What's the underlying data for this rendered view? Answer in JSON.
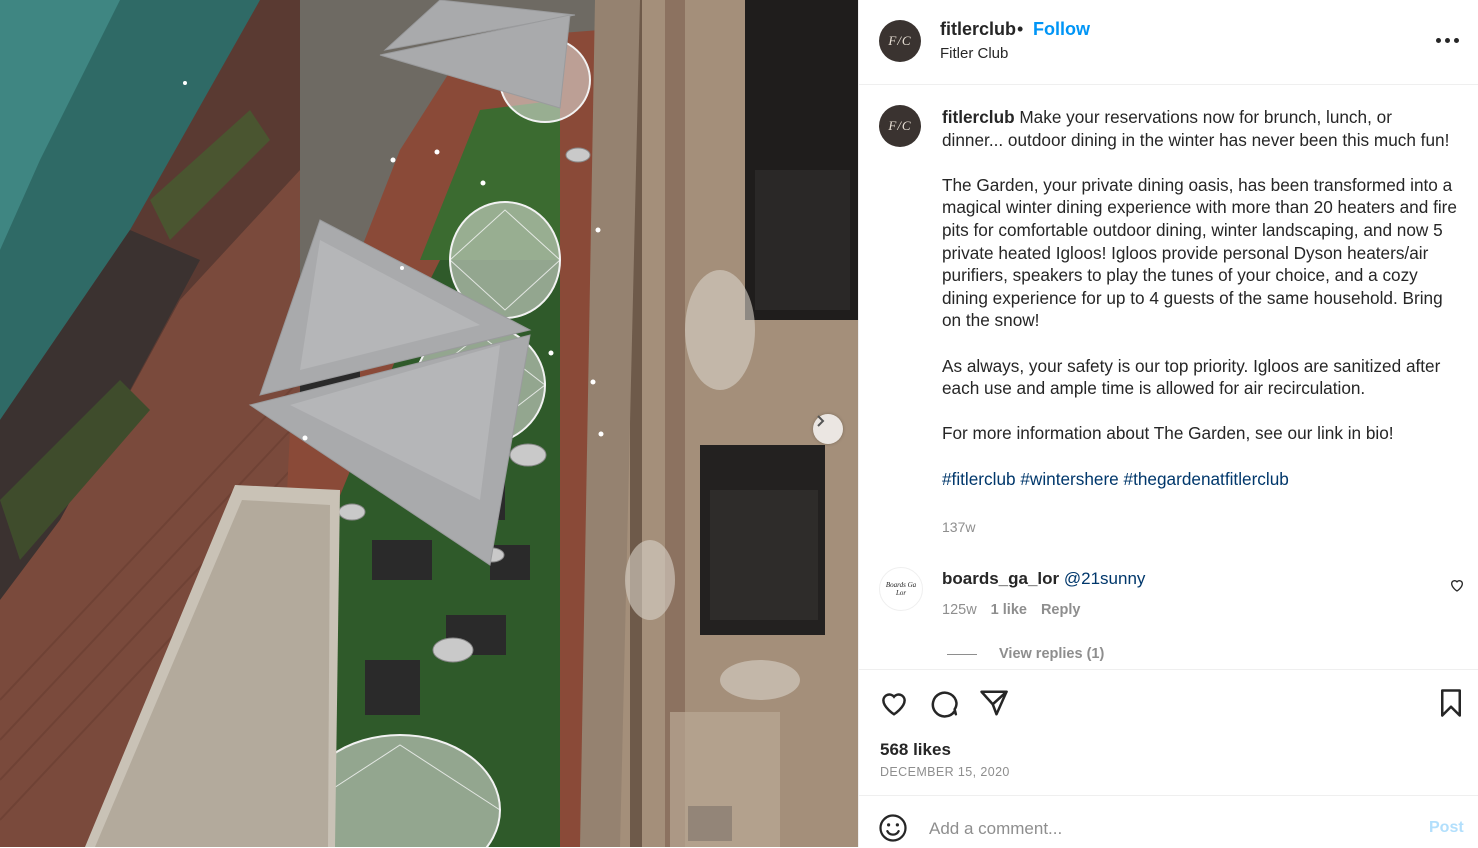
{
  "post": {
    "username": "fitlerclub",
    "separator": "•",
    "follow_label": "Follow",
    "subtitle": "Fitler Club",
    "avatar_monogram": "F/C"
  },
  "caption": {
    "username": "fitlerclub",
    "text_1": " Make your reservations now for brunch, lunch, or dinner... outdoor dining in the winter has never been this much fun!\n\nThe Garden, your private dining oasis, has been transformed into a magical winter dining experience with more than 20 heaters and fire pits for comfortable outdoor dining, winter landscaping, and now 5 private heated Igloos! Igloos provide personal Dyson heaters/air purifiers, speakers to play the tunes of your choice, and a cozy dining experience for up to 4 guests of the same household. Bring on the snow!\n\nAs always, your safety is our top priority. Igloos are sanitized after each use and ample time is allowed for air recirculation.\n\nFor more information about The Garden, see our link in bio!\n\n",
    "hashtags": [
      "#fitlerclub",
      "#wintershere",
      "#thegardenatfitlerclub"
    ],
    "age": "137w"
  },
  "comment": {
    "username": "boards_ga_lor",
    "mention": "@21sunny",
    "avatar_text": "Boards Ga Lor",
    "age": "125w",
    "likes": "1 like",
    "reply_label": "Reply",
    "view_replies": "View replies (1)"
  },
  "footer": {
    "likes": "568 likes",
    "date": "DECEMBER 15, 2020",
    "comment_placeholder": "Add a comment...",
    "post_label": "Post"
  },
  "icons": {
    "like": "heart-icon",
    "comment": "speech-bubble-icon",
    "share": "paper-plane-icon",
    "save": "bookmark-icon",
    "emoji": "smiley-icon",
    "next": "chevron-right-icon",
    "more": "ellipsis-icon"
  },
  "colors": {
    "follow": "#0095f6",
    "hashtag": "#00376b",
    "muted": "#8e8e8e",
    "post_disabled": "#b2dffc"
  }
}
